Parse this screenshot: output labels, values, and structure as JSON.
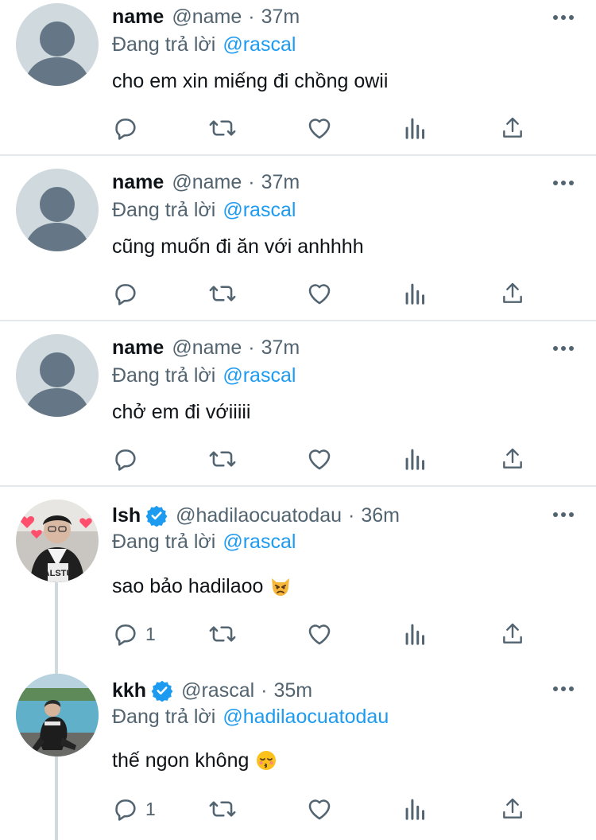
{
  "reply_prefix": "Đang trả lời",
  "tweets": [
    {
      "display_name": "name",
      "handle": "@name",
      "time": "37m",
      "reply_to": "@rascal",
      "text": "cho em xin miếng đi chồng owii",
      "reply_count": "",
      "avatar": "default-avatar",
      "verified": false
    },
    {
      "display_name": "name",
      "handle": "@name",
      "time": "37m",
      "reply_to": "@rascal",
      "text": "cũng muốn đi ăn với anhhhh",
      "reply_count": "",
      "avatar": "default-avatar",
      "verified": false
    },
    {
      "display_name": "name",
      "handle": "@name",
      "time": "37m",
      "reply_to": "@rascal",
      "text": "chở em đi vớiiiii",
      "reply_count": "",
      "avatar": "default-avatar",
      "verified": false
    },
    {
      "display_name": "lsh",
      "handle": "@hadilaocuatodau",
      "time": "36m",
      "reply_to": "@rascal",
      "text": "sao bảo hadilaoo",
      "emoji": "pouting-cat-emoji",
      "reply_count": "1",
      "avatar": "photo-avatar",
      "verified": true
    },
    {
      "display_name": "kkh",
      "handle": "@rascal",
      "time": "35m",
      "reply_to": "@hadilaocuatodau",
      "text": "thế ngon không",
      "emoji": "kissing-face-closed-eyes-emoji",
      "reply_count": "1",
      "avatar": "photo-avatar",
      "verified": true
    }
  ],
  "colors": {
    "accent": "#1d9bf0",
    "secondary_text": "#536471",
    "divider": "#e6e9ec",
    "avatar_placeholder": "#cfd9de"
  },
  "icons": [
    "more-icon",
    "reply-icon",
    "retweet-icon",
    "like-icon",
    "analytics-icon",
    "share-icon",
    "verified-badge-icon"
  ]
}
